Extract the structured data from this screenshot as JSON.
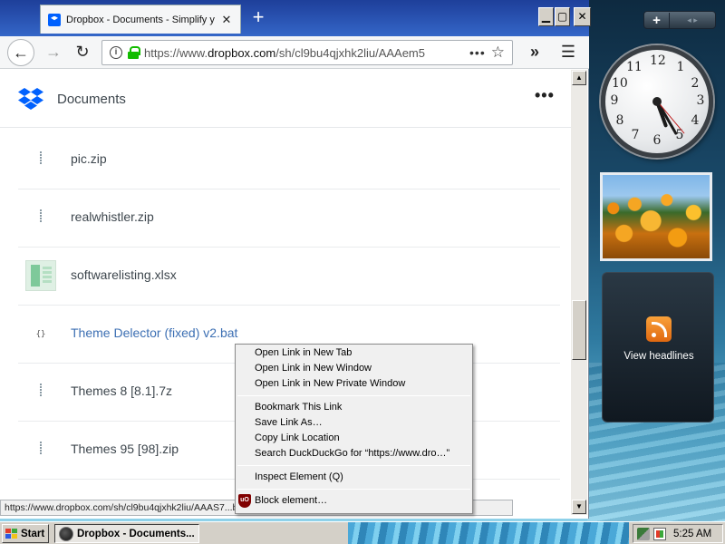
{
  "browser": {
    "tab_title": "Dropbox - Documents - Simplify yo",
    "tab_close": "✕",
    "new_tab": "+",
    "window_controls": {
      "minimize": "▁",
      "maximize": "▢",
      "close": "✕"
    },
    "url_prefix": "https://www.",
    "url_domain": "dropbox.com",
    "url_path": "/sh/cl9bu4qjxhk2liu/AAAem5",
    "url_more": "•••",
    "status_url": "https://www.dropbox.com/sh/cl9bu4qjxhk2liu/AAAS7...bat?dl=0"
  },
  "page": {
    "title": "Documents",
    "more": "•••",
    "files": [
      {
        "name": "pic.zip",
        "icon": "zip-icon"
      },
      {
        "name": "realwhistler.zip",
        "icon": "zip-icon"
      },
      {
        "name": "softwarelisting.xlsx",
        "icon": "spreadsheet-icon"
      },
      {
        "name": "Theme Delector (fixed) v2.bat",
        "icon": "code-file-icon",
        "icon_text": "{}"
      },
      {
        "name": "Themes 8 [8.1].7z",
        "icon": "zip-icon"
      },
      {
        "name": "Themes 95 [98].zip",
        "icon": "zip-icon"
      }
    ]
  },
  "context_menu": {
    "items": [
      "Open Link in New Tab",
      "Open Link in New Window",
      "Open Link in New Private Window",
      "Bookmark This Link",
      "Save Link As…",
      "Copy Link Location",
      "Search DuckDuckGo for “https://www.dro…”",
      "Inspect Element (Q)",
      "Block element…"
    ],
    "ublock_badge": "uO"
  },
  "gadgets": {
    "add": "+",
    "nav": "◂ ▸",
    "clock_numbers": [
      "12",
      "1",
      "2",
      "3",
      "4",
      "5",
      "6",
      "7",
      "8",
      "9",
      "10",
      "11"
    ],
    "feed_label": "View headlines"
  },
  "taskbar": {
    "start": "Start",
    "task": "Dropbox - Documents...",
    "time": "5:25 AM"
  },
  "colors": {
    "dropbox_blue": "#0061fe",
    "link_blue": "#3c6fb3",
    "title_bar": "#1e3f9a"
  }
}
